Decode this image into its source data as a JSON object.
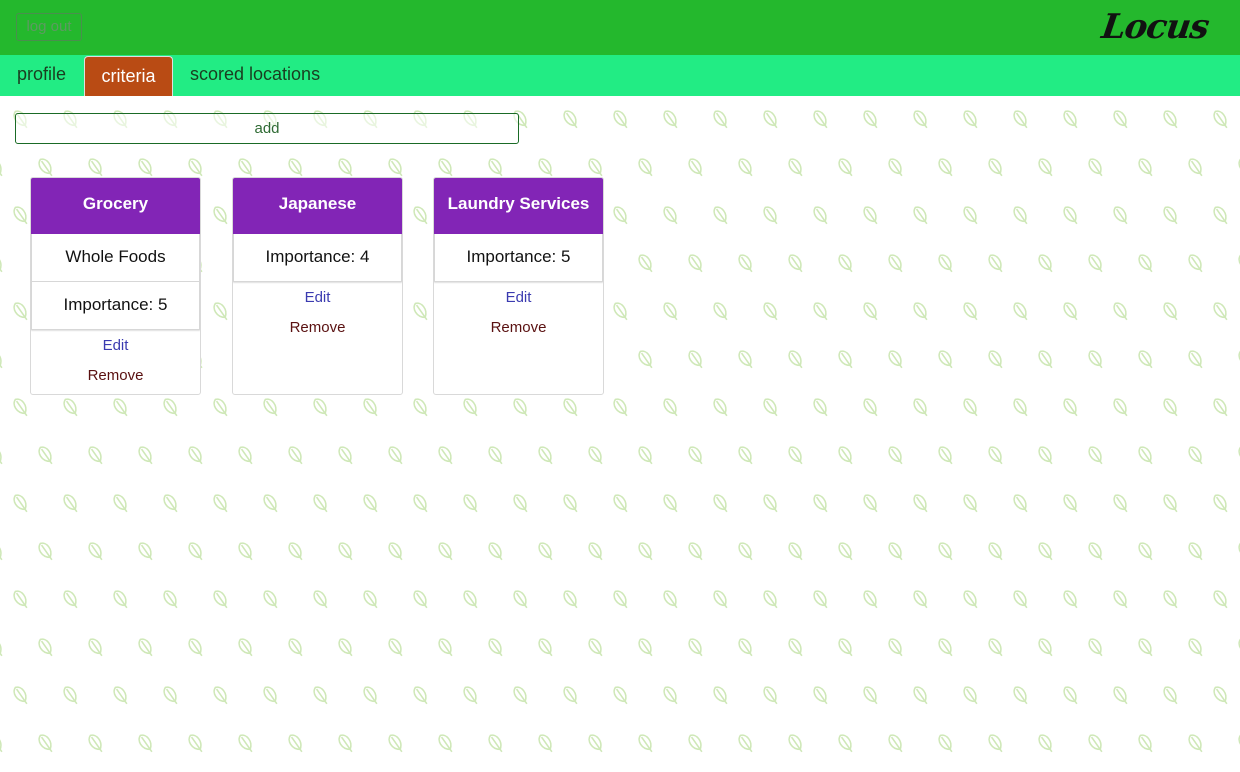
{
  "header": {
    "logout_label": "log out",
    "logo_text": "Locus",
    "color": "#24b82d"
  },
  "tabs": [
    {
      "label": "profile",
      "active": false
    },
    {
      "label": "criteria",
      "active": true
    },
    {
      "label": "scored locations",
      "active": false
    }
  ],
  "tab_bar_color": "#22ec84",
  "active_tab_color": "#b94b14",
  "add_button_label": "add",
  "card_header_color": "#8225b6",
  "criteria": [
    {
      "title": "Grocery",
      "rows": [
        "Whole Foods",
        "Importance: 5"
      ],
      "edit_label": "Edit",
      "remove_label": "Remove"
    },
    {
      "title": "Japanese",
      "rows": [
        "Importance: 4"
      ],
      "edit_label": "Edit",
      "remove_label": "Remove"
    },
    {
      "title": "Laundry Services",
      "rows": [
        "Importance: 5"
      ],
      "edit_label": "Edit",
      "remove_label": "Remove"
    }
  ],
  "background": {
    "pattern_icon": "leaf-icon",
    "pattern_color": "#cfe8b8"
  }
}
